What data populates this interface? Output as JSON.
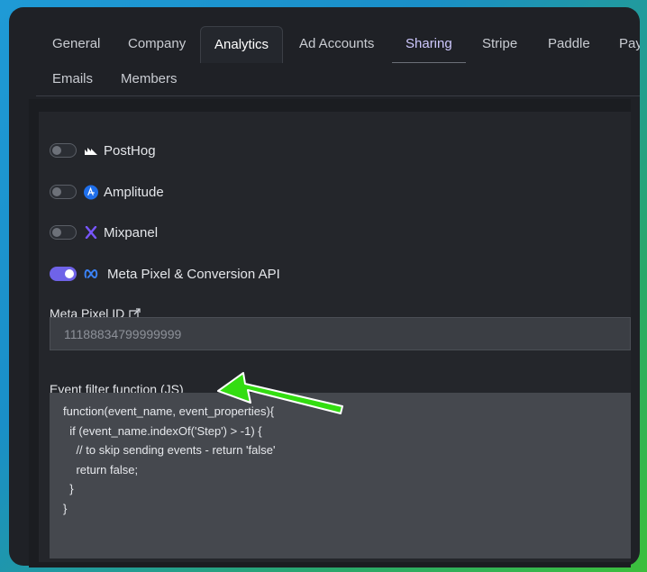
{
  "tabs": {
    "row1": [
      "General",
      "Company",
      "Analytics",
      "Ad Accounts",
      "Sharing",
      "Stripe",
      "Paddle",
      "Pay"
    ],
    "row2": [
      "Emails",
      "Members"
    ]
  },
  "integrations": [
    {
      "label": "PostHog",
      "enabled": false,
      "icon": "posthog-icon"
    },
    {
      "label": "Amplitude",
      "enabled": false,
      "icon": "amplitude-icon"
    },
    {
      "label": "Mixpanel",
      "enabled": false,
      "icon": "mixpanel-icon"
    },
    {
      "label": "Meta Pixel & Conversion API",
      "enabled": true,
      "icon": "meta-icon"
    }
  ],
  "meta_pixel": {
    "label": "Meta Pixel ID",
    "value": "11188834799999999"
  },
  "event_filter": {
    "label": "Event filter function (JS)",
    "code": "function(event_name, event_properties){\n  if (event_name.indexOf('Step') > -1) {\n    // to skip sending events - return 'false'\n    return false;\n  }\n}"
  },
  "colors": {
    "accent": "#6f63e8",
    "annotation_arrow": "#33dd11"
  }
}
